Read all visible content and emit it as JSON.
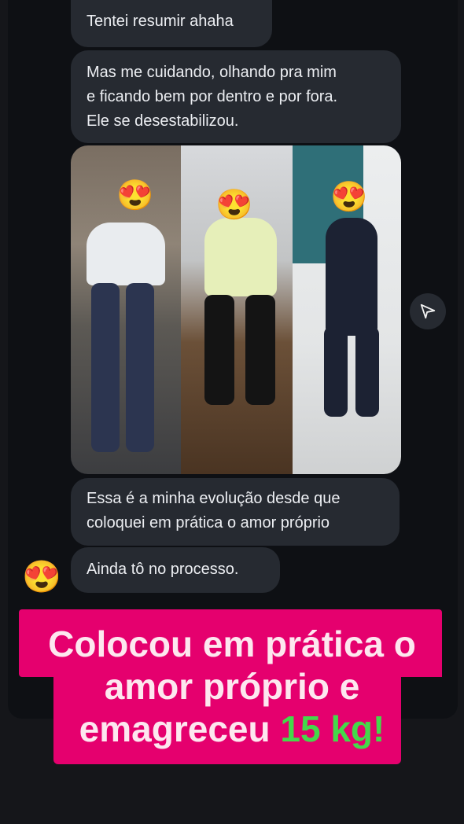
{
  "messages": [
    {
      "id": "m1",
      "text": "Tentei resumir ahaha"
    },
    {
      "id": "m2",
      "text": "Mas me cuidando, olhando pra mim\ne ficando bem por dentro e por fora.\nEle se desestabilizou."
    },
    {
      "id": "m3",
      "text": "Essa é a minha evolução desde que\ncoloquei em prática o amor próprio"
    },
    {
      "id": "m4",
      "text": "Ainda tô no processo."
    }
  ],
  "photo": {
    "emoji_cover": "😍",
    "panels": [
      "before",
      "middle",
      "after"
    ]
  },
  "sender": {
    "emoji": "😍"
  },
  "share_icon": "paper-plane-icon",
  "caption": {
    "line1": "Colocou em prática o",
    "line2": "amor próprio e",
    "line3_prefix": "emagreceu ",
    "line3_highlight": "15 kg!",
    "background_color": "#e5006e",
    "highlight_color": "#45d84a"
  }
}
